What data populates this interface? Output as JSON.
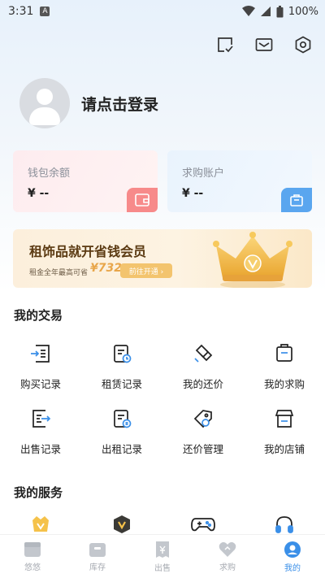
{
  "status_bar": {
    "time": "3:31",
    "badge": "A",
    "battery": "100%"
  },
  "header": {
    "icons": [
      "checklist-icon",
      "mail-icon",
      "settings-icon"
    ]
  },
  "profile": {
    "login_text": "请点击登录"
  },
  "wallet_card": {
    "title": "钱包余额",
    "value": "¥ --"
  },
  "account_card": {
    "title": "求购账户",
    "value": "¥ --"
  },
  "vip_banner": {
    "title": "租饰品就开省钱会员",
    "subtitle": "租金全年最高可省",
    "amount": "¥732",
    "button": "前往开通 ›"
  },
  "trade": {
    "title": "我的交易",
    "items": [
      {
        "label": "购买记录",
        "icon": "purchase-record-icon"
      },
      {
        "label": "租赁记录",
        "icon": "rent-record-icon"
      },
      {
        "label": "我的还价",
        "icon": "bargain-icon"
      },
      {
        "label": "我的求购",
        "icon": "wanted-icon"
      },
      {
        "label": "出售记录",
        "icon": "sale-record-icon"
      },
      {
        "label": "出租记录",
        "icon": "lease-record-icon"
      },
      {
        "label": "还价管理",
        "icon": "bargain-manage-icon"
      },
      {
        "label": "我的店铺",
        "icon": "store-icon"
      }
    ]
  },
  "services": {
    "title": "我的服务",
    "icons": [
      "vip-badge-icon",
      "vip-shield-icon",
      "gamepad-icon",
      "headset-icon"
    ]
  },
  "tabbar": {
    "items": [
      {
        "label": "悠悠",
        "icon": "home-icon"
      },
      {
        "label": "库存",
        "icon": "inventory-icon"
      },
      {
        "label": "出售",
        "icon": "sell-icon"
      },
      {
        "label": "求购",
        "icon": "wanted-tab-icon"
      },
      {
        "label": "我的",
        "icon": "profile-icon"
      }
    ],
    "active_index": 4
  },
  "colors": {
    "accent": "#3a8fe8",
    "wallet_icon_bg": "#f78a8a",
    "account_icon_bg": "#5aa6ef",
    "vip_gold": "#f3c46e"
  }
}
